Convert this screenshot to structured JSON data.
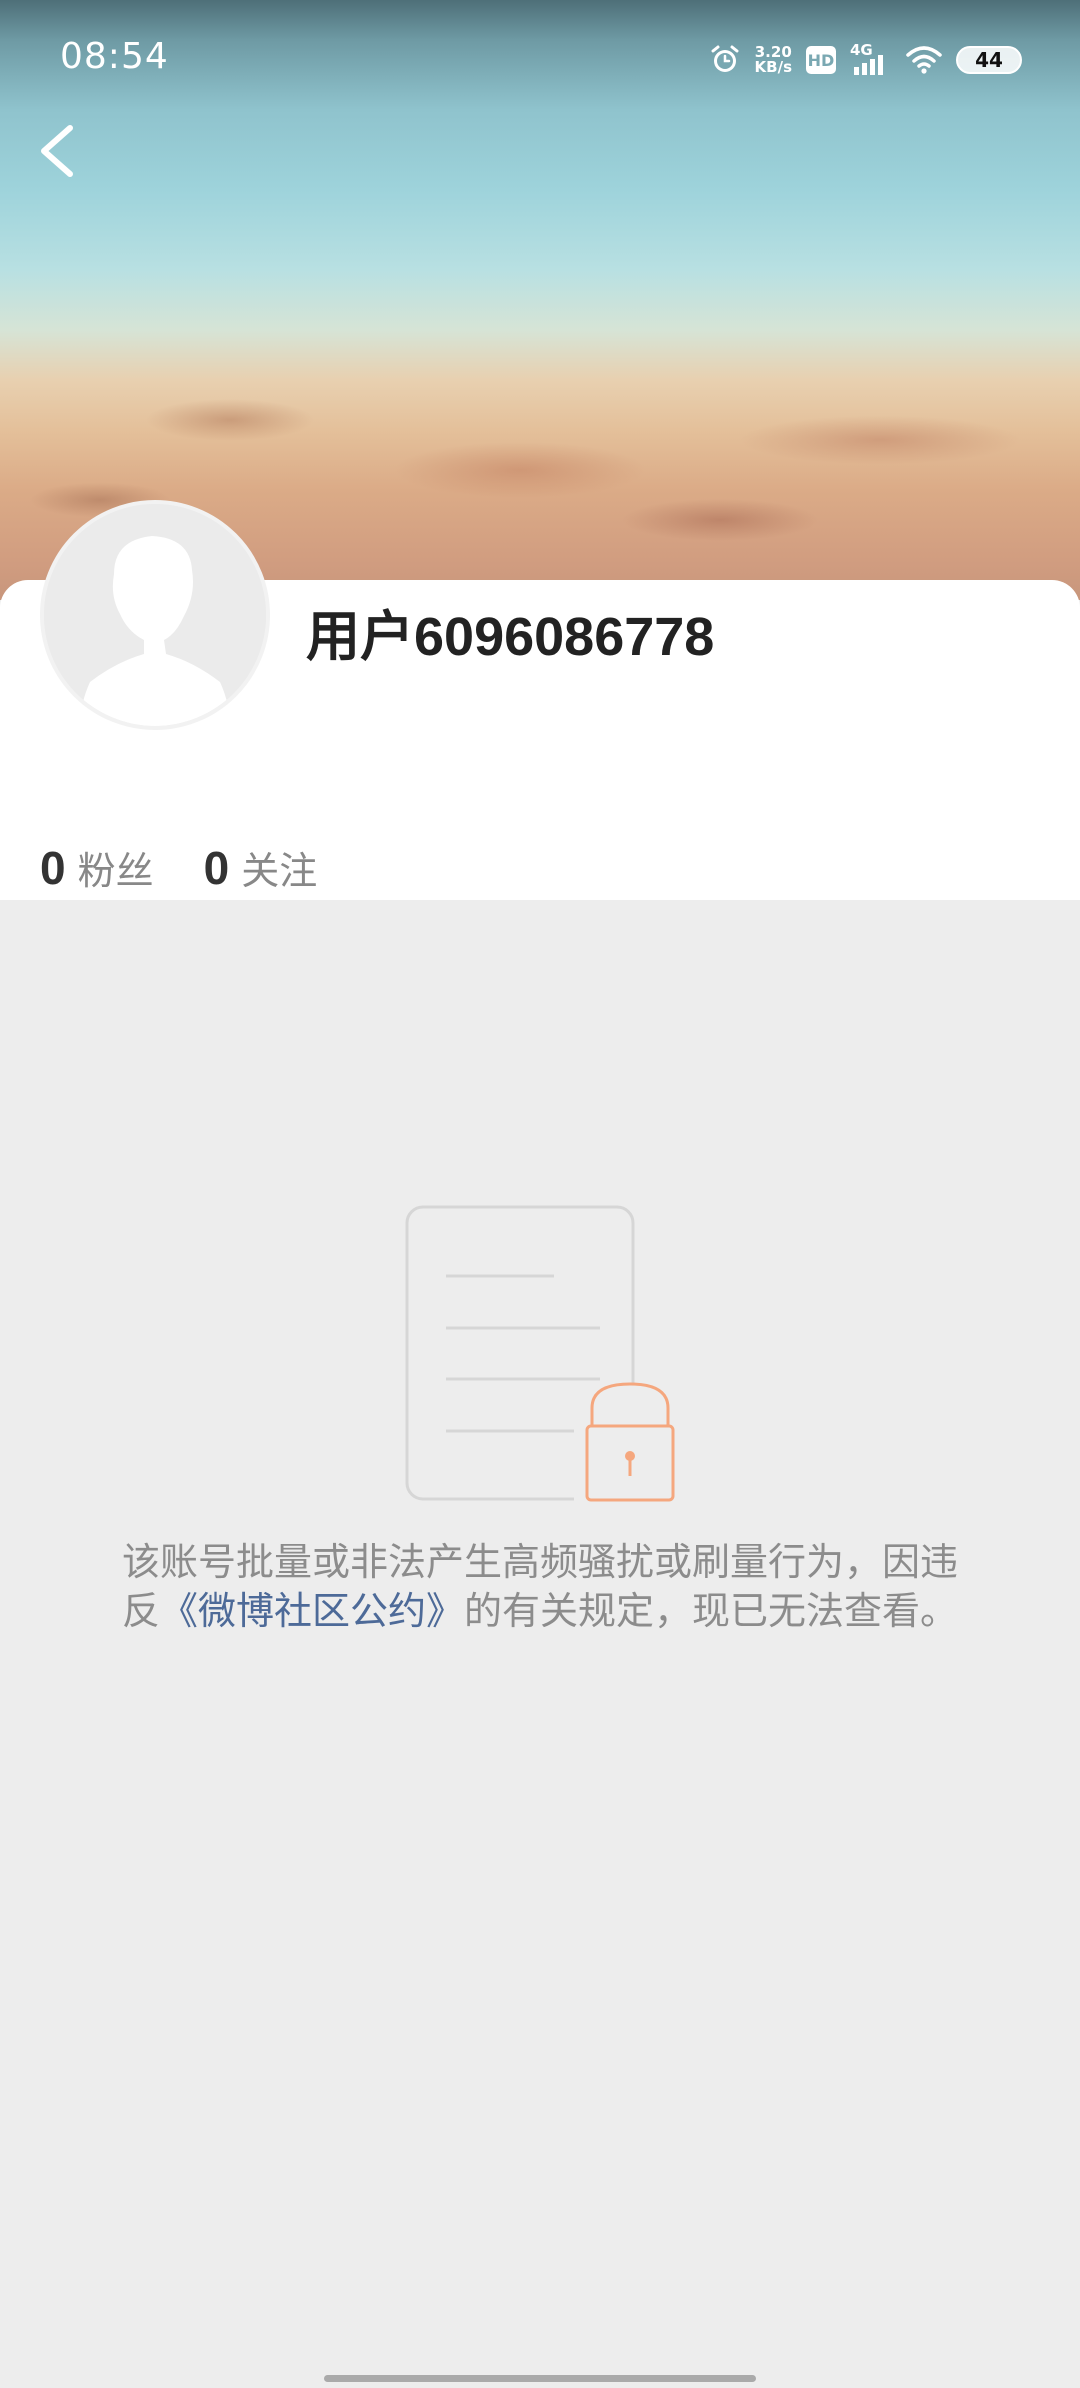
{
  "status_bar": {
    "time": "08:54",
    "net_speed_value": "3.20",
    "net_speed_unit": "KB/s",
    "hd_label": "HD",
    "network_label": "4G",
    "battery_level": "44"
  },
  "profile": {
    "username": "用户6096086778",
    "followers_count": "0",
    "followers_label": "粉丝",
    "following_count": "0",
    "following_label": "关注"
  },
  "notice": {
    "line_part1": "该账号批量或非法产生高频骚扰或刷量行为，因违反",
    "link_text": "《微博社区公约》",
    "line_part2": "的有关规定，现已无法查看。"
  },
  "colors": {
    "accent_lock": "#f5a77e",
    "link": "#4d6a98",
    "background": "#ededed"
  },
  "icons": {
    "back": "chevron-left-icon",
    "lock": "lock-icon",
    "document": "document-icon",
    "avatar": "default-avatar-icon"
  }
}
